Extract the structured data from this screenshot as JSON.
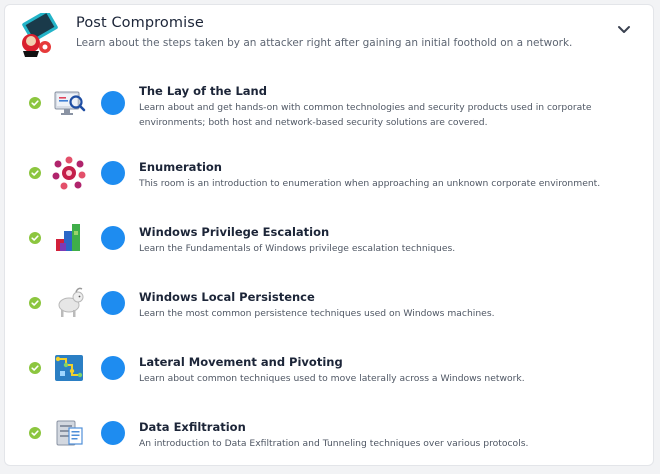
{
  "module": {
    "title": "Post Compromise",
    "description": "Learn about the steps taken by an attacker right after gaining an initial foothold on a network.",
    "icon": "hacker-laptop-icon",
    "expand_icon": "chevron-down-icon"
  },
  "rooms": [
    {
      "title": "The Lay of the Land",
      "description": "Learn about and get hands-on with common technologies and security products used in corporate environments; both host and network-based security solutions are covered.",
      "completed": true,
      "icon": "monitor-magnifier-icon"
    },
    {
      "title": "Enumeration",
      "description": "This room is an introduction to enumeration when approaching an unknown corporate environment.",
      "completed": true,
      "icon": "network-nodes-icon"
    },
    {
      "title": "Windows Privilege Escalation",
      "description": "Learn the Fundamentals of Windows privilege escalation techniques.",
      "completed": true,
      "icon": "bar-chart-blocks-icon"
    },
    {
      "title": "Windows Local Persistence",
      "description": "Learn the most common persistence techniques used on Windows machines.",
      "completed": true,
      "icon": "goat-icon"
    },
    {
      "title": "Lateral Movement and Pivoting",
      "description": "Learn about common techniques used to move laterally across a Windows network.",
      "completed": true,
      "icon": "network-map-icon"
    },
    {
      "title": "Data Exfiltration",
      "description": "An introduction to Data Exfiltration and Tunneling techniques over various protocols.",
      "completed": true,
      "icon": "server-document-icon"
    }
  ],
  "colors": {
    "check": "#8cc63f",
    "progress_dot": "#1e8cf0"
  }
}
